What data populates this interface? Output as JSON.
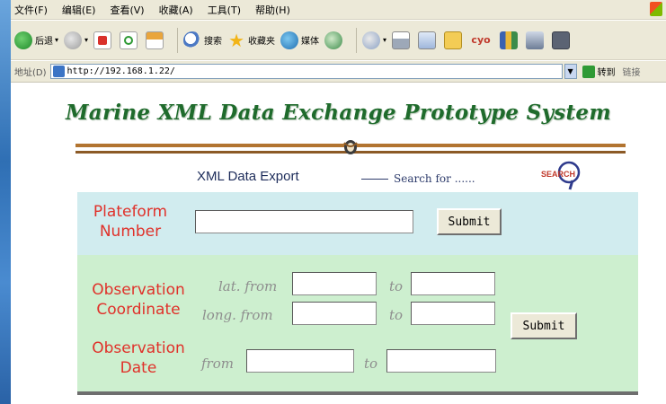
{
  "menubar": {
    "items": [
      "文件(F)",
      "编辑(E)",
      "查看(V)",
      "收藏(A)",
      "工具(T)",
      "帮助(H)"
    ]
  },
  "toolbar": {
    "back_label": "后退",
    "search_label": "搜索",
    "favorites_label": "收藏夹",
    "media_label": "媒体"
  },
  "addressbar": {
    "label": "地址(D)",
    "url": "http://192.168.1.22/",
    "go_label": "转到",
    "links_label": "链接"
  },
  "page": {
    "title": "Marine XML Data Exchange Prototype System",
    "subtitle": "XML Data Export",
    "search_for": "Search for ......",
    "search_badge": "SEARCH",
    "platform_label_1": "Plateform",
    "platform_label_2": "Number",
    "platform_value": "",
    "submit_label": "Submit",
    "coord_label_1": "Observation",
    "coord_label_2": "Coordinate",
    "lat_from_label": "lat. from",
    "long_from_label": "long. from",
    "to_label": "to",
    "lat_from_value": "",
    "lat_to_value": "",
    "long_from_value": "",
    "long_to_value": "",
    "date_label_1": "Observation",
    "date_label_2": "Date",
    "date_from_label": "from",
    "date_from_value": "",
    "date_to_value": ""
  },
  "colors": {
    "title_green": "#1f6b2c",
    "label_red": "#e0312a",
    "panel_blue": "#d1ecef",
    "panel_green": "#cdefcf",
    "rule_brown": "#b27430"
  }
}
